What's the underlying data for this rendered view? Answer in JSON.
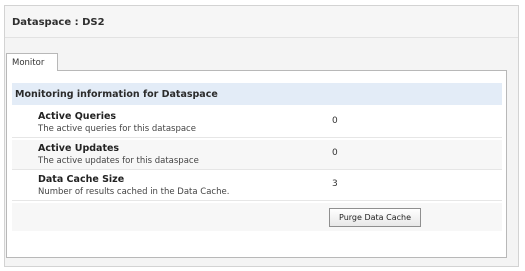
{
  "header": {
    "title": "Dataspace : DS2"
  },
  "tabs": [
    {
      "label": "Monitor"
    }
  ],
  "section": {
    "title": "Monitoring information for Dataspace"
  },
  "rows": [
    {
      "label": "Active Queries",
      "description": "The active queries for this dataspace",
      "value": "0"
    },
    {
      "label": "Active Updates",
      "description": "The active updates for this dataspace",
      "value": "0"
    },
    {
      "label": "Data Cache Size",
      "description": "Number of results cached in the Data Cache.",
      "value": "3"
    }
  ],
  "actions": {
    "purge_label": "Purge Data Cache"
  }
}
